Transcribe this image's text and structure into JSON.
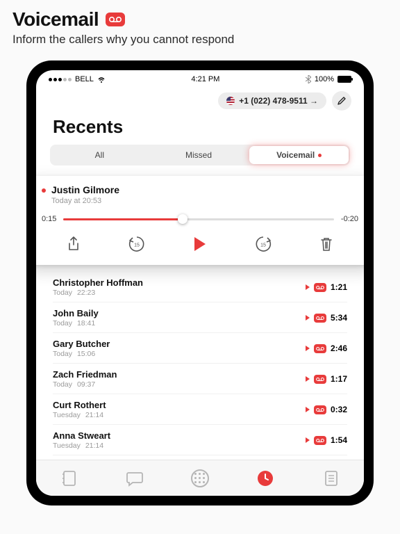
{
  "promo": {
    "title": "Voicemail",
    "subtitle": "Inform the callers why you cannot respond"
  },
  "status": {
    "carrier": "BELL",
    "time": "4:21 PM",
    "battery": "100%"
  },
  "header": {
    "phone_number": "+1 (022) 478-9511 →",
    "page_title": "Recents"
  },
  "segmented": {
    "all": "All",
    "missed": "Missed",
    "voicemail": "Voicemail"
  },
  "player": {
    "name": "Justin Gilmore",
    "when": "Today at 20:53",
    "elapsed": "0:15",
    "remaining": "-0:20",
    "skip_seconds": "15"
  },
  "recents": [
    {
      "name": "Christopher Hoffman",
      "day": "Today",
      "time": "22:23",
      "duration": "1:21"
    },
    {
      "name": "John Baily",
      "day": "Today",
      "time": "18:41",
      "duration": "5:34"
    },
    {
      "name": "Gary Butcher",
      "day": "Today",
      "time": "15:06",
      "duration": "2:46"
    },
    {
      "name": "Zach Friedman",
      "day": "Today",
      "time": "09:37",
      "duration": "1:17"
    },
    {
      "name": "Curt Rothert",
      "day": "Tuesday",
      "time": "21:14",
      "duration": "0:32"
    },
    {
      "name": "Anna Stweart",
      "day": "Tuesday",
      "time": "21:14",
      "duration": "1:54"
    }
  ],
  "colors": {
    "accent": "#e83b3b"
  }
}
